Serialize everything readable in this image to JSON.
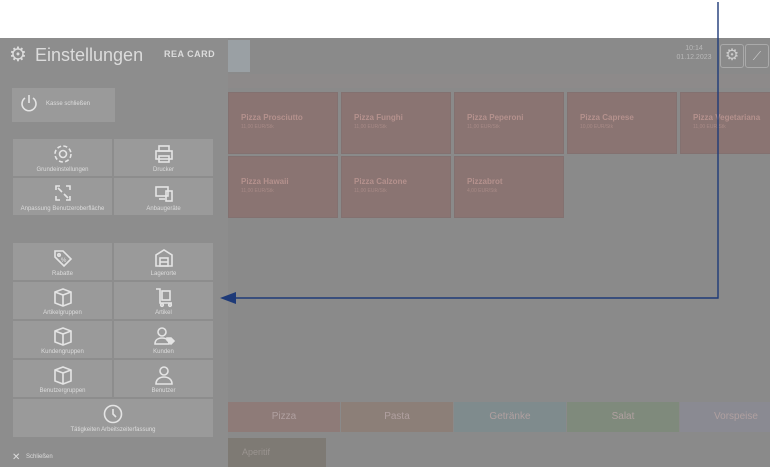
{
  "header": {
    "title": "Einstellungen",
    "brand": "REA CARD",
    "time": "10:14",
    "date": "01.12.2023"
  },
  "panel": {
    "close_cash_label": "Kasse schließen",
    "group1": [
      {
        "label": "Grundeinstellungen",
        "icon": "gear-icon"
      },
      {
        "label": "Drucker",
        "icon": "printer-icon"
      },
      {
        "label": "Anpassung Benutzeroberfläche",
        "icon": "fullscreen-icon"
      },
      {
        "label": "Anbaugeräte",
        "icon": "devices-icon"
      }
    ],
    "group2": [
      {
        "label": "Rabatte",
        "icon": "discount-tag-icon"
      },
      {
        "label": "Lagerorte",
        "icon": "warehouse-icon"
      },
      {
        "label": "Artikelgruppen",
        "icon": "box-icon"
      },
      {
        "label": "Artikel",
        "icon": "cart-item-icon"
      },
      {
        "label": "Kundengruppen",
        "icon": "box-icon"
      },
      {
        "label": "Kunden",
        "icon": "customer-tag-icon"
      },
      {
        "label": "Benutzergruppen",
        "icon": "box-icon"
      },
      {
        "label": "Benutzer",
        "icon": "user-icon"
      },
      {
        "label": "Tätigkeiten Arbeitszeiterfassung",
        "icon": "clock-icon"
      }
    ],
    "close_label": "Schließen"
  },
  "products": [
    {
      "name": "Pizza Prosciutto",
      "price": "11,00 EUR/Stk"
    },
    {
      "name": "Pizza Funghi",
      "price": "11,00 EUR/Stk"
    },
    {
      "name": "Pizza Peperoni",
      "price": "11,00 EUR/Stk"
    },
    {
      "name": "Pizza Caprese",
      "price": "10,00 EUR/Stk"
    },
    {
      "name": "Pizza Vegetariana",
      "price": "11,00 EUR/Stk"
    },
    {
      "name": "Pizza Hawaii",
      "price": "11,00 EUR/Stk"
    },
    {
      "name": "Pizza Calzone",
      "price": "11,00 EUR/Stk"
    },
    {
      "name": "Pizzabrot",
      "price": "4,00 EUR/Stk"
    }
  ],
  "categories": [
    {
      "label": "Pizza",
      "color": "#8e7b78"
    },
    {
      "label": "Pasta",
      "color": "#8c7f78"
    },
    {
      "label": "Getränke",
      "color": "#7f8b8d"
    },
    {
      "label": "Salat",
      "color": "#7f8a7c"
    },
    {
      "label": "Vorspeise",
      "color": "#8a8a92"
    }
  ],
  "aperitif_label": "Aperitif",
  "colors": {
    "overlay": "#8d8d8d",
    "tile": "#9a9a9a",
    "arrow": "#1e3a78"
  }
}
